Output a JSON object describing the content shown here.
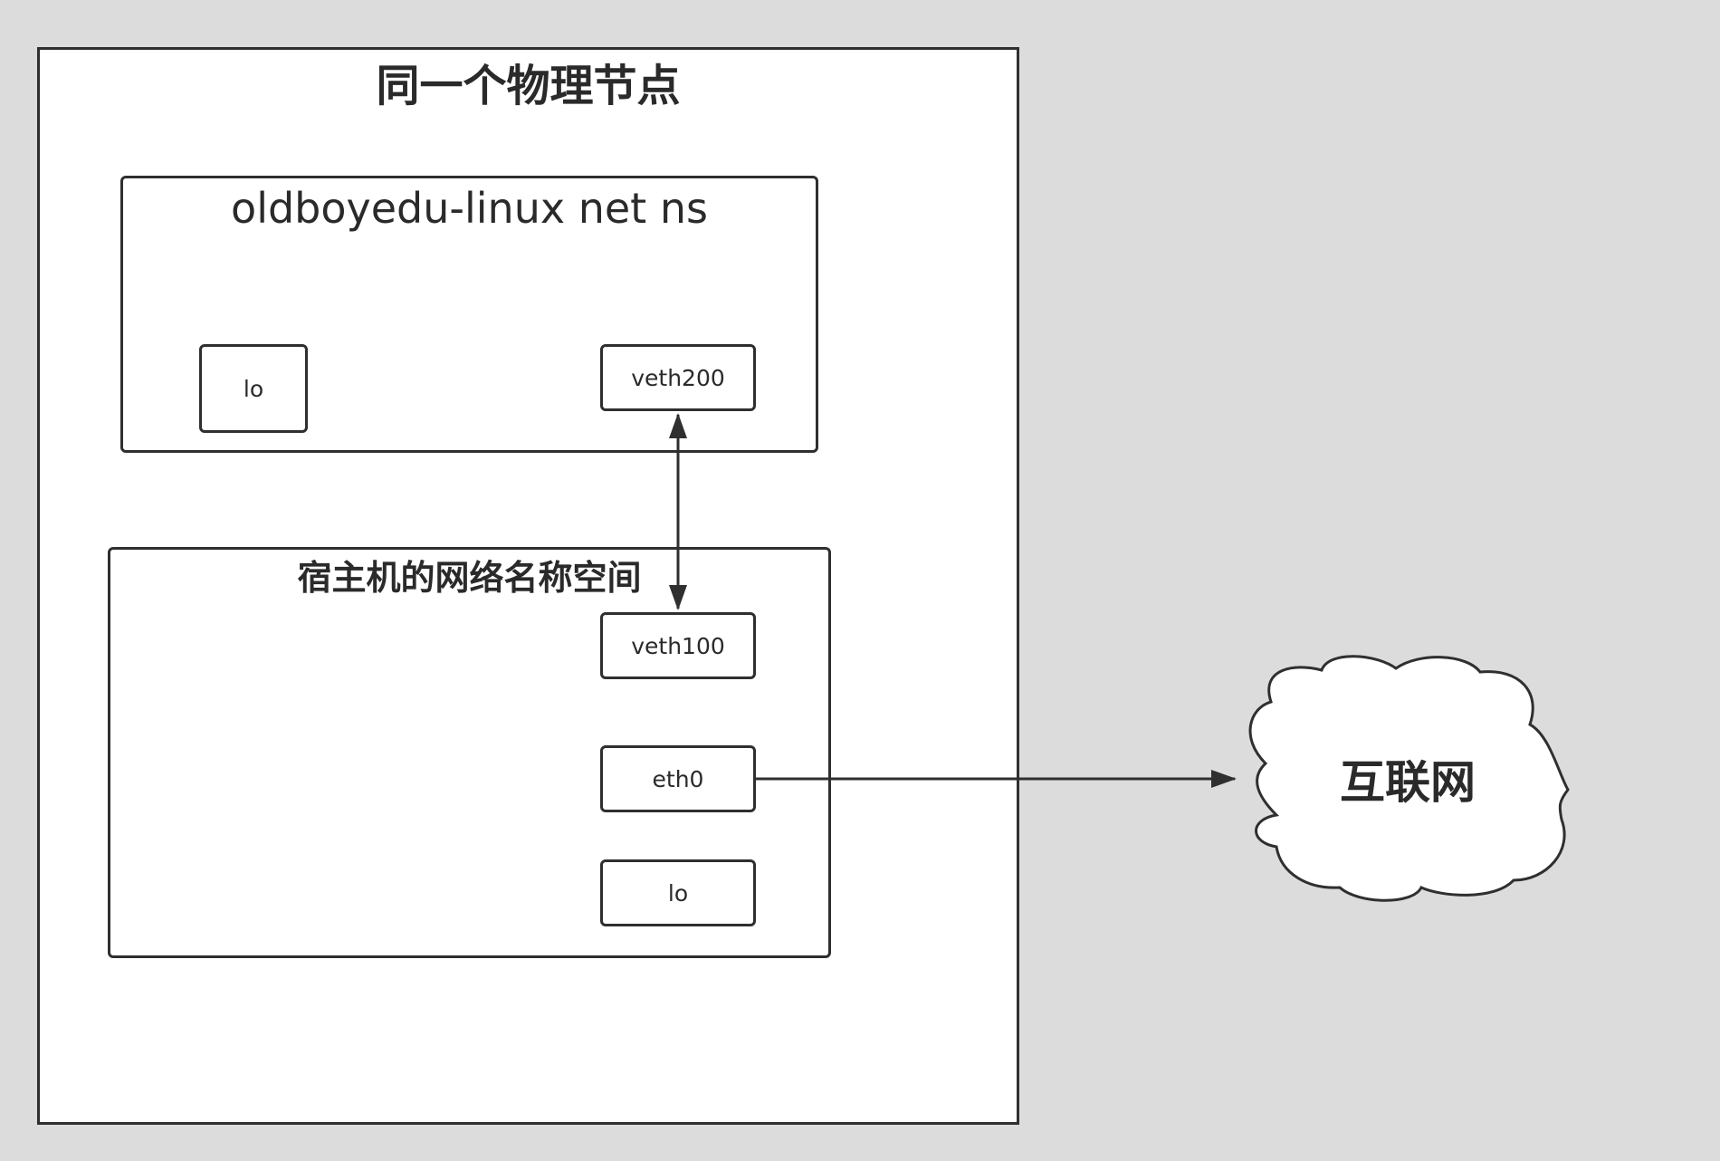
{
  "physical_node": {
    "title": "同一个物理节点"
  },
  "netns": {
    "title": "oldboyedu-linux net ns",
    "interfaces": {
      "lo": "lo",
      "veth200": "veth200"
    }
  },
  "host_ns": {
    "title": "宿主机的网络名称空间",
    "interfaces": {
      "veth100": "veth100",
      "eth0": "eth0",
      "lo": "lo"
    }
  },
  "internet": {
    "label": "互联网"
  },
  "colors": {
    "background": "#dcdcdc",
    "stroke": "#2f2f2f",
    "fill": "#ffffff"
  }
}
